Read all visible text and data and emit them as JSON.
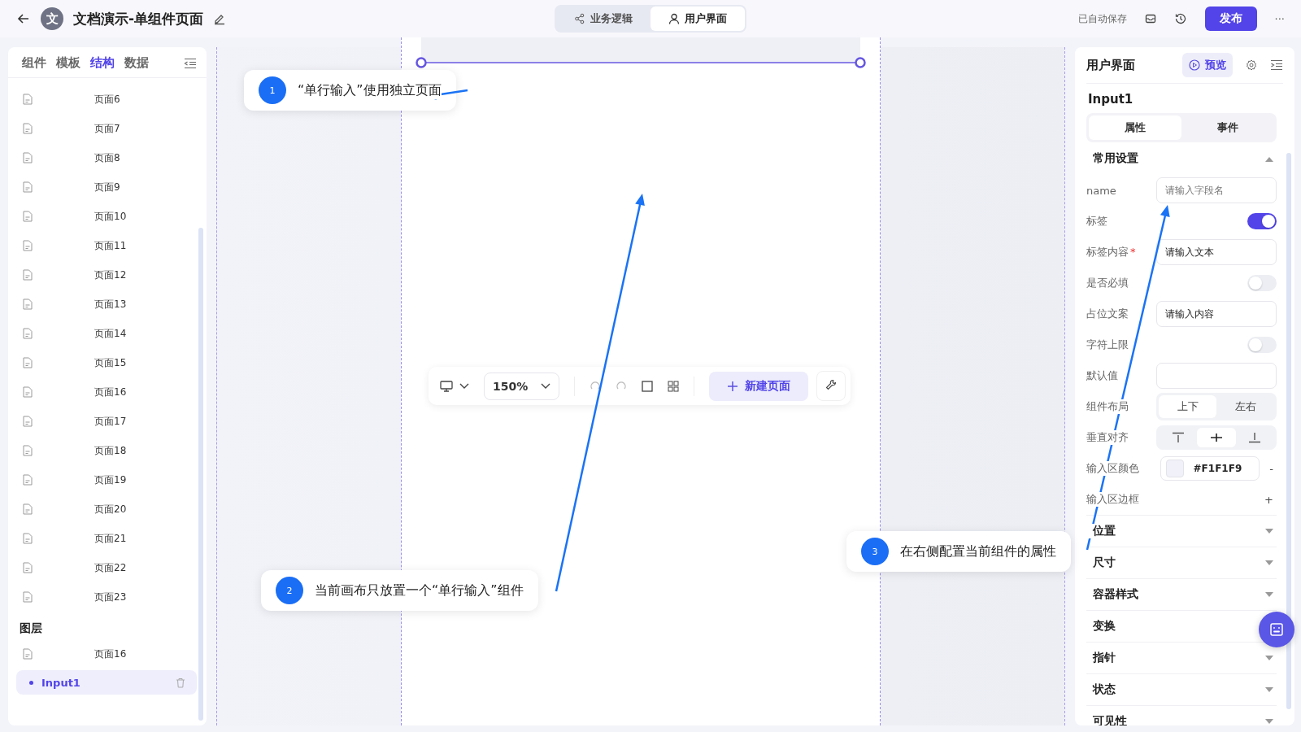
{
  "header": {
    "avatar_letter": "文",
    "title": "文档演示-单组件页面",
    "tabs": [
      {
        "label": "业务逻辑",
        "kind": "share",
        "selected": false
      },
      {
        "label": "用户界面",
        "kind": "user",
        "selected": true
      }
    ],
    "autosave": "已自动保存",
    "publish": "发布",
    "more": "···"
  },
  "left_panel": {
    "tabs": [
      {
        "label": "组件",
        "selected": false
      },
      {
        "label": "模板",
        "selected": false
      },
      {
        "label": "结构",
        "selected": true
      },
      {
        "label": "数据",
        "selected": false
      }
    ],
    "pages": [
      "页面6",
      "页面7",
      "页面8",
      "页面9",
      "页面10",
      "页面11",
      "页面12",
      "页面13",
      "页面14",
      "页面15",
      "页面16",
      "页面17",
      "页面18",
      "页面19",
      "页面20",
      "页面21",
      "页面22",
      "页面23"
    ],
    "layers_title": "图层",
    "layers": [
      {
        "label": "页面16",
        "children": [
          {
            "label": "Input1",
            "selected": true
          }
        ]
      }
    ]
  },
  "canvas": {
    "toolbar": {
      "zoom": "150%",
      "new_page": "新建页面"
    },
    "callouts": [
      {
        "number": "1",
        "text": "“单行输入”使用独立页面"
      },
      {
        "number": "2",
        "text": "当前画布只放置一个“单行输入”组件"
      },
      {
        "number": "3",
        "text": "在右侧配置当前组件的属性"
      }
    ]
  },
  "right_panel": {
    "title": "用户界面",
    "preview": "预览",
    "component": "Input1",
    "tabs": [
      {
        "label": "属性",
        "selected": true
      },
      {
        "label": "事件",
        "selected": false
      }
    ],
    "section": {
      "title": "常用设置",
      "expanded": true
    },
    "rows": [
      {
        "kind": "input",
        "label": "name",
        "placeholder": "请输入字段名"
      },
      {
        "kind": "toggle",
        "label": "标签",
        "on": true
      },
      {
        "kind": "input",
        "label": "标签内容",
        "required_mark": "*",
        "value": "请输入文本"
      },
      {
        "kind": "toggle",
        "label": "是否必填",
        "on": false
      },
      {
        "kind": "input",
        "label": "占位文案",
        "value": "请输入内容"
      },
      {
        "kind": "toggle",
        "label": "字符上限",
        "on": false
      },
      {
        "kind": "input",
        "label": "默认值"
      },
      {
        "kind": "segmented",
        "label": "组件布局",
        "options": [
          {
            "label": "上下",
            "selected": true
          },
          {
            "label": "左右",
            "selected": false
          }
        ]
      },
      {
        "kind": "align",
        "label": "垂直对齐",
        "options": [
          {
            "kind": "top",
            "selected": false
          },
          {
            "kind": "middle",
            "selected": true
          },
          {
            "kind": "bottom",
            "selected": false
          }
        ]
      },
      {
        "kind": "color",
        "label": "输入区颜色",
        "value": "#F1F1F9",
        "color": "#f1f1f9",
        "action": "-"
      },
      {
        "kind": "add",
        "label": "输入区边框",
        "action": "+"
      }
    ],
    "collapsed_sections": [
      {
        "title": "位置",
        "expanded": false
      },
      {
        "title": "尺寸",
        "expanded": false
      },
      {
        "title": "容器样式",
        "expanded": false
      },
      {
        "title": "变换"
      },
      {
        "title": "指针",
        "expanded": false
      },
      {
        "title": "状态",
        "expanded": false
      },
      {
        "title": "可见性",
        "expanded": false
      }
    ]
  }
}
